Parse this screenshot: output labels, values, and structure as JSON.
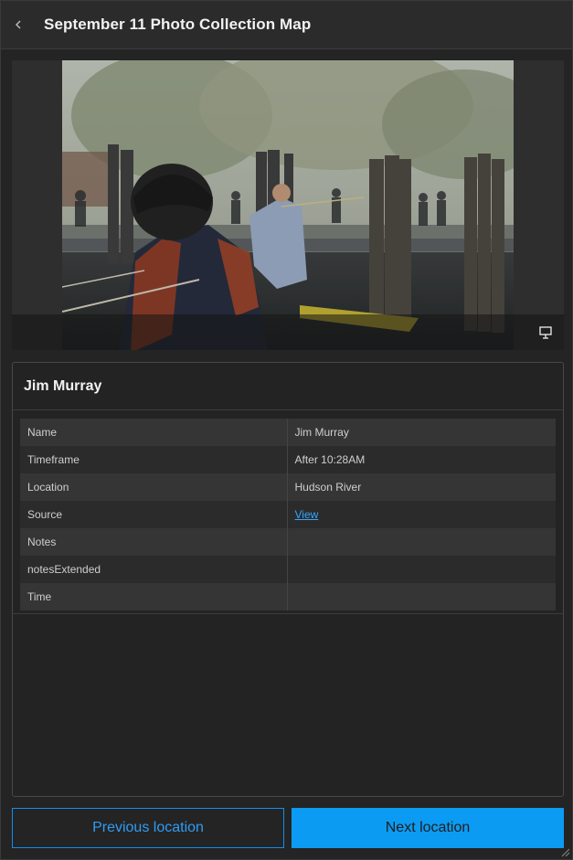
{
  "header": {
    "title": "September 11 Photo Collection Map",
    "back_icon": "chevron-left-icon"
  },
  "media": {
    "photo_alt": "Ferry dock on the Hudson River",
    "toolbar_icon": "presentation-icon"
  },
  "card": {
    "title": "Jim Murray",
    "fields": [
      {
        "key": "Name",
        "value": "Jim Murray"
      },
      {
        "key": "Timeframe",
        "value": "After 10:28AM"
      },
      {
        "key": "Location",
        "value": "Hudson River"
      },
      {
        "key": "Source",
        "value": "View",
        "link": true
      },
      {
        "key": "Notes",
        "value": ""
      },
      {
        "key": "notesExtended",
        "value": ""
      },
      {
        "key": "Time",
        "value": ""
      }
    ]
  },
  "footer": {
    "prev_label": "Previous location",
    "next_label": "Next location"
  },
  "colors": {
    "accent": "#0c9bf2",
    "link": "#35a6ff",
    "background": "#242424"
  }
}
